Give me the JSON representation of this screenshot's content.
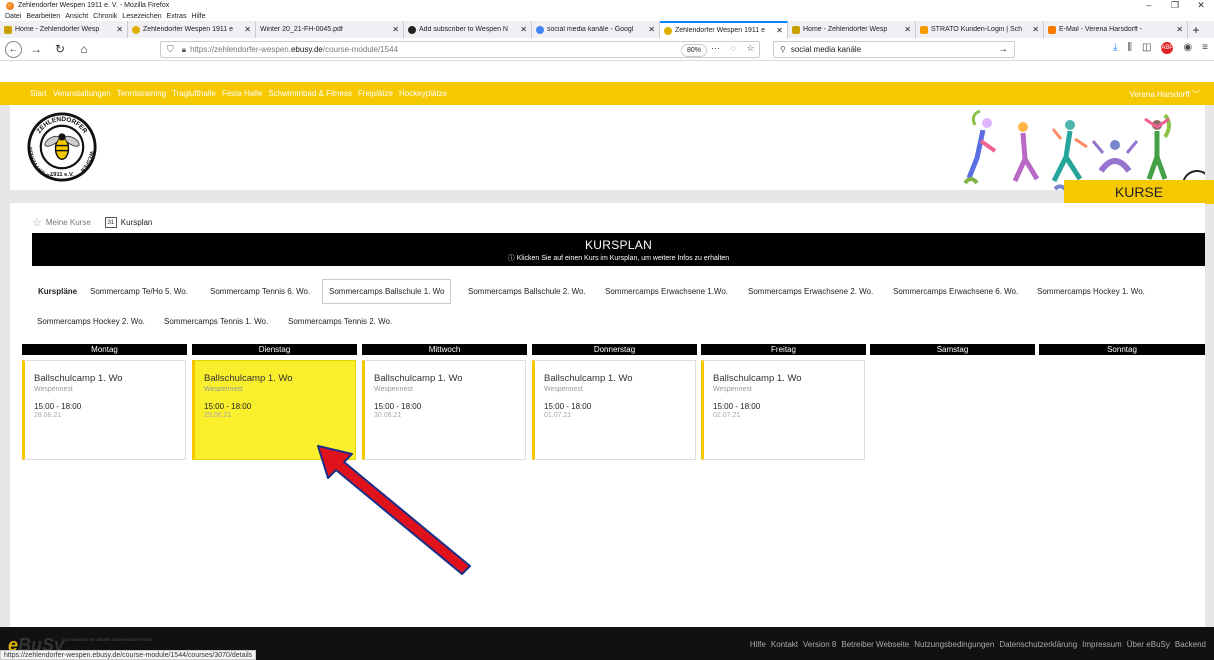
{
  "window": {
    "title": "Zehlendorfer Wespen 1911 e. V. - Mozilla Firefox",
    "controls": [
      "–",
      "❐",
      "✕"
    ]
  },
  "menubar": [
    "Datei",
    "Bearbeiten",
    "Ansicht",
    "Chronik",
    "Lesezeichen",
    "Extras",
    "Hilfe"
  ],
  "tabs": [
    {
      "label": "Home - Zehlendorfer Wesp",
      "color": "#c8a000"
    },
    {
      "label": "Zehlendorfer Wespen 1911 e",
      "color": "#e0b000"
    },
    {
      "label": "Winter 20_21-FH-0045.pdf",
      "color": "#ffffff"
    },
    {
      "label": "Add subscriber to Wespen N",
      "color": "#222222"
    },
    {
      "label": "social media kanäle - Googl",
      "color": "#4285f4"
    },
    {
      "label": "Zehlendorfer Wespen 1911 e",
      "color": "#e0b000"
    },
    {
      "label": "Home - Zehlendorfer Wesp",
      "color": "#c8a000"
    },
    {
      "label": "STRATO Kunden-Login | Sch",
      "color": "#f59a00"
    },
    {
      "label": "E-Mail - Verena Harsdorff - ",
      "color": "#f57c00"
    }
  ],
  "nav": {
    "url_prefix": "https://zehlendorfer-wespen.",
    "url_domain": "ebusy.de",
    "url_path": "/course-module/1544",
    "zoom": "80%",
    "search_value": "social media kanäle"
  },
  "sitenav": {
    "items": [
      "Start",
      "Veranstaltungen",
      "Tennistraining",
      "Traglufthalle",
      "Feste Halle",
      "Schwimmbad & Fitness",
      "Freiplätze",
      "Hockeyplätze"
    ],
    "user": "Verena Harsdorff ﹀"
  },
  "header": {
    "logo_text_top": "ZEHLENDORFER",
    "logo_text_left": "SPORTVEREIN",
    "logo_text_right": "WESPEN",
    "logo_text_bottom": "1911 e.V.",
    "kurse_label": "KURSE"
  },
  "breadcrumb": {
    "meine_kurse": "Meine Kurse",
    "cal_icon_text": "31",
    "kursplan": "Kursplan"
  },
  "kursplan": {
    "title": "KURSPLAN",
    "subtitle": "ⓘ  Klicken Sie auf einen Kurs im Kursplan, um weitere Infos zu erhalten"
  },
  "course_tabs": [
    "Kurspläne",
    "Sommercamp Te/Ho 5. Wo.",
    "Sommercamp Tennis 6. Wo.",
    "Sommercamps Ballschule 1. Wo",
    "Sommercamps Ballschule 2. Wo.",
    "Sommercamps Erwachsene 1.Wo.",
    "Sommercamps Erwachsene 2. Wo.",
    "Sommercamps Erwachsene 6. Wo.",
    "Sommercamps Hockey 1. Wo.",
    "Sommercamps Hockey 2. Wo.",
    "Sommercamps Tennis 1. Wo.",
    "Sommercamps Tennis 2. Wo."
  ],
  "days": [
    "Montag",
    "Dienstag",
    "Mittwoch",
    "Donnerstag",
    "Freitag",
    "Samstag",
    "Sonntag"
  ],
  "courses": [
    {
      "name": "Ballschulcamp 1. Wo",
      "location": "Wespennest",
      "time": "15:00 - 18:00",
      "date": "28.06.21"
    },
    {
      "name": "Ballschulcamp 1. Wo",
      "location": "Wespennest",
      "time": "15:00 - 18:00",
      "date": "29.06.21"
    },
    {
      "name": "Ballschulcamp 1. Wo",
      "location": "Wespennest",
      "time": "15:00 - 18:00",
      "date": "30.06.21"
    },
    {
      "name": "Ballschulcamp 1. Wo",
      "location": "Wespennest",
      "time": "15:00 - 18:00",
      "date": "01.07.21"
    },
    {
      "name": "Ballschulcamp 1. Wo",
      "location": "Wespennest",
      "time": "15:00 - 18:00",
      "date": "02.07.21"
    }
  ],
  "footer": {
    "brand_e": "e",
    "brand_name": "BuSy",
    "brand_tagline": "DAS INNOVATIVE ONLINE BUCHUNGSSYSTEM",
    "links": [
      "Hilfe",
      "Kontakt",
      "Version 8",
      "Betreiber Webseite",
      "Nutzungsbedingungen",
      "Datenschutzerklärung",
      "Impressum",
      "Über eBuSy",
      "Backend"
    ]
  },
  "statusbar": "https://zehlendorfer-wespen.ebusy.de/course-module/1544/courses/3070/details",
  "colors": {
    "accent_yellow": "#f5c800",
    "highlight_card": "#f9ef2c",
    "annotation_arrow": "#e0121b",
    "annotation_arrow_outline": "#1a2f8a"
  }
}
